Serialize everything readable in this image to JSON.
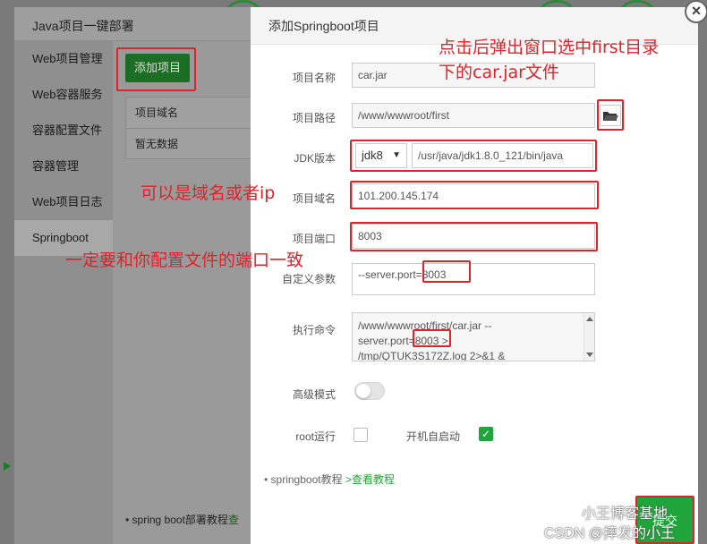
{
  "background": {
    "title": "Java项目一键部署",
    "nav": [
      "Web项目管理",
      "Web容器服务",
      "容器配置文件",
      "容器管理",
      "Web项目日志",
      "Springboot"
    ],
    "add_button": "添加项目",
    "table_header": "项目域名",
    "table_empty": "暂无数据",
    "footer_text": "spring boot部署教程",
    "footer_link": "查"
  },
  "modal": {
    "title": "添加Springboot项目",
    "labels": {
      "name": "项目名称",
      "path": "项目路径",
      "jdk": "JDK版本",
      "domain": "项目域名",
      "port": "项目端口",
      "params": "自定义参数",
      "cmd": "执行命令",
      "advanced": "高级模式",
      "root": "root运行",
      "autostart": "开机自启动"
    },
    "values": {
      "name": "car.jar",
      "path": "/www/wwwroot/first",
      "jdk_select": "jdk8",
      "jdk_path": "/usr/java/jdk1.8.0_121/bin/java",
      "domain": "101.200.145.174",
      "port": "8003",
      "params_prefix": "--server.port=",
      "params_port": "8003",
      "cmd_line1": "/www/wwwroot/first/car.jar --",
      "cmd_line2_prefix": "server.port=",
      "cmd_line2_port": "8003",
      "cmd_line2_suffix": " >",
      "cmd_line3": "/tmp/QTUK3S172Z.log 2>&1 &"
    },
    "toggles": {
      "advanced": false,
      "root": false,
      "autostart": true
    },
    "tutorial_text": "springboot教程",
    "tutorial_link": ">查看教程",
    "submit": "提交"
  },
  "annotations": {
    "top_right_line1": "点击后弹出窗口选中first目录",
    "top_right_line2": "下的car.jar文件",
    "domain_note": "可以是域名或者ip",
    "port_note": "一定要和你配置文件的端口一致"
  },
  "watermark": {
    "line1": "小王博客基地",
    "line2": "CSDN @摔发的小王"
  },
  "colors": {
    "accent_green": "#20a53a",
    "annotation_red": "#e0222a",
    "overlay_grey": "#9a9a9a"
  }
}
